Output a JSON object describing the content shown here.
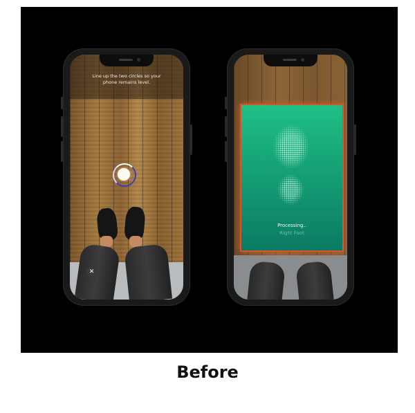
{
  "caption": "Before",
  "phone_left": {
    "instruction": "Line up the two circles so your phone remains level.",
    "close_symbol": "✕",
    "icons": [
      "close-icon",
      "level-circle-icon"
    ]
  },
  "phone_right": {
    "status": "Processing..",
    "subtext": "Right Foot",
    "colors": {
      "panel_top": "#1fbf85",
      "panel_bottom": "#0b7a63",
      "panel_border": "#d4542c"
    }
  },
  "colors": {
    "stage_background": "#000000",
    "page_background": "#ffffff",
    "level_ring": "#3d3fb8"
  }
}
